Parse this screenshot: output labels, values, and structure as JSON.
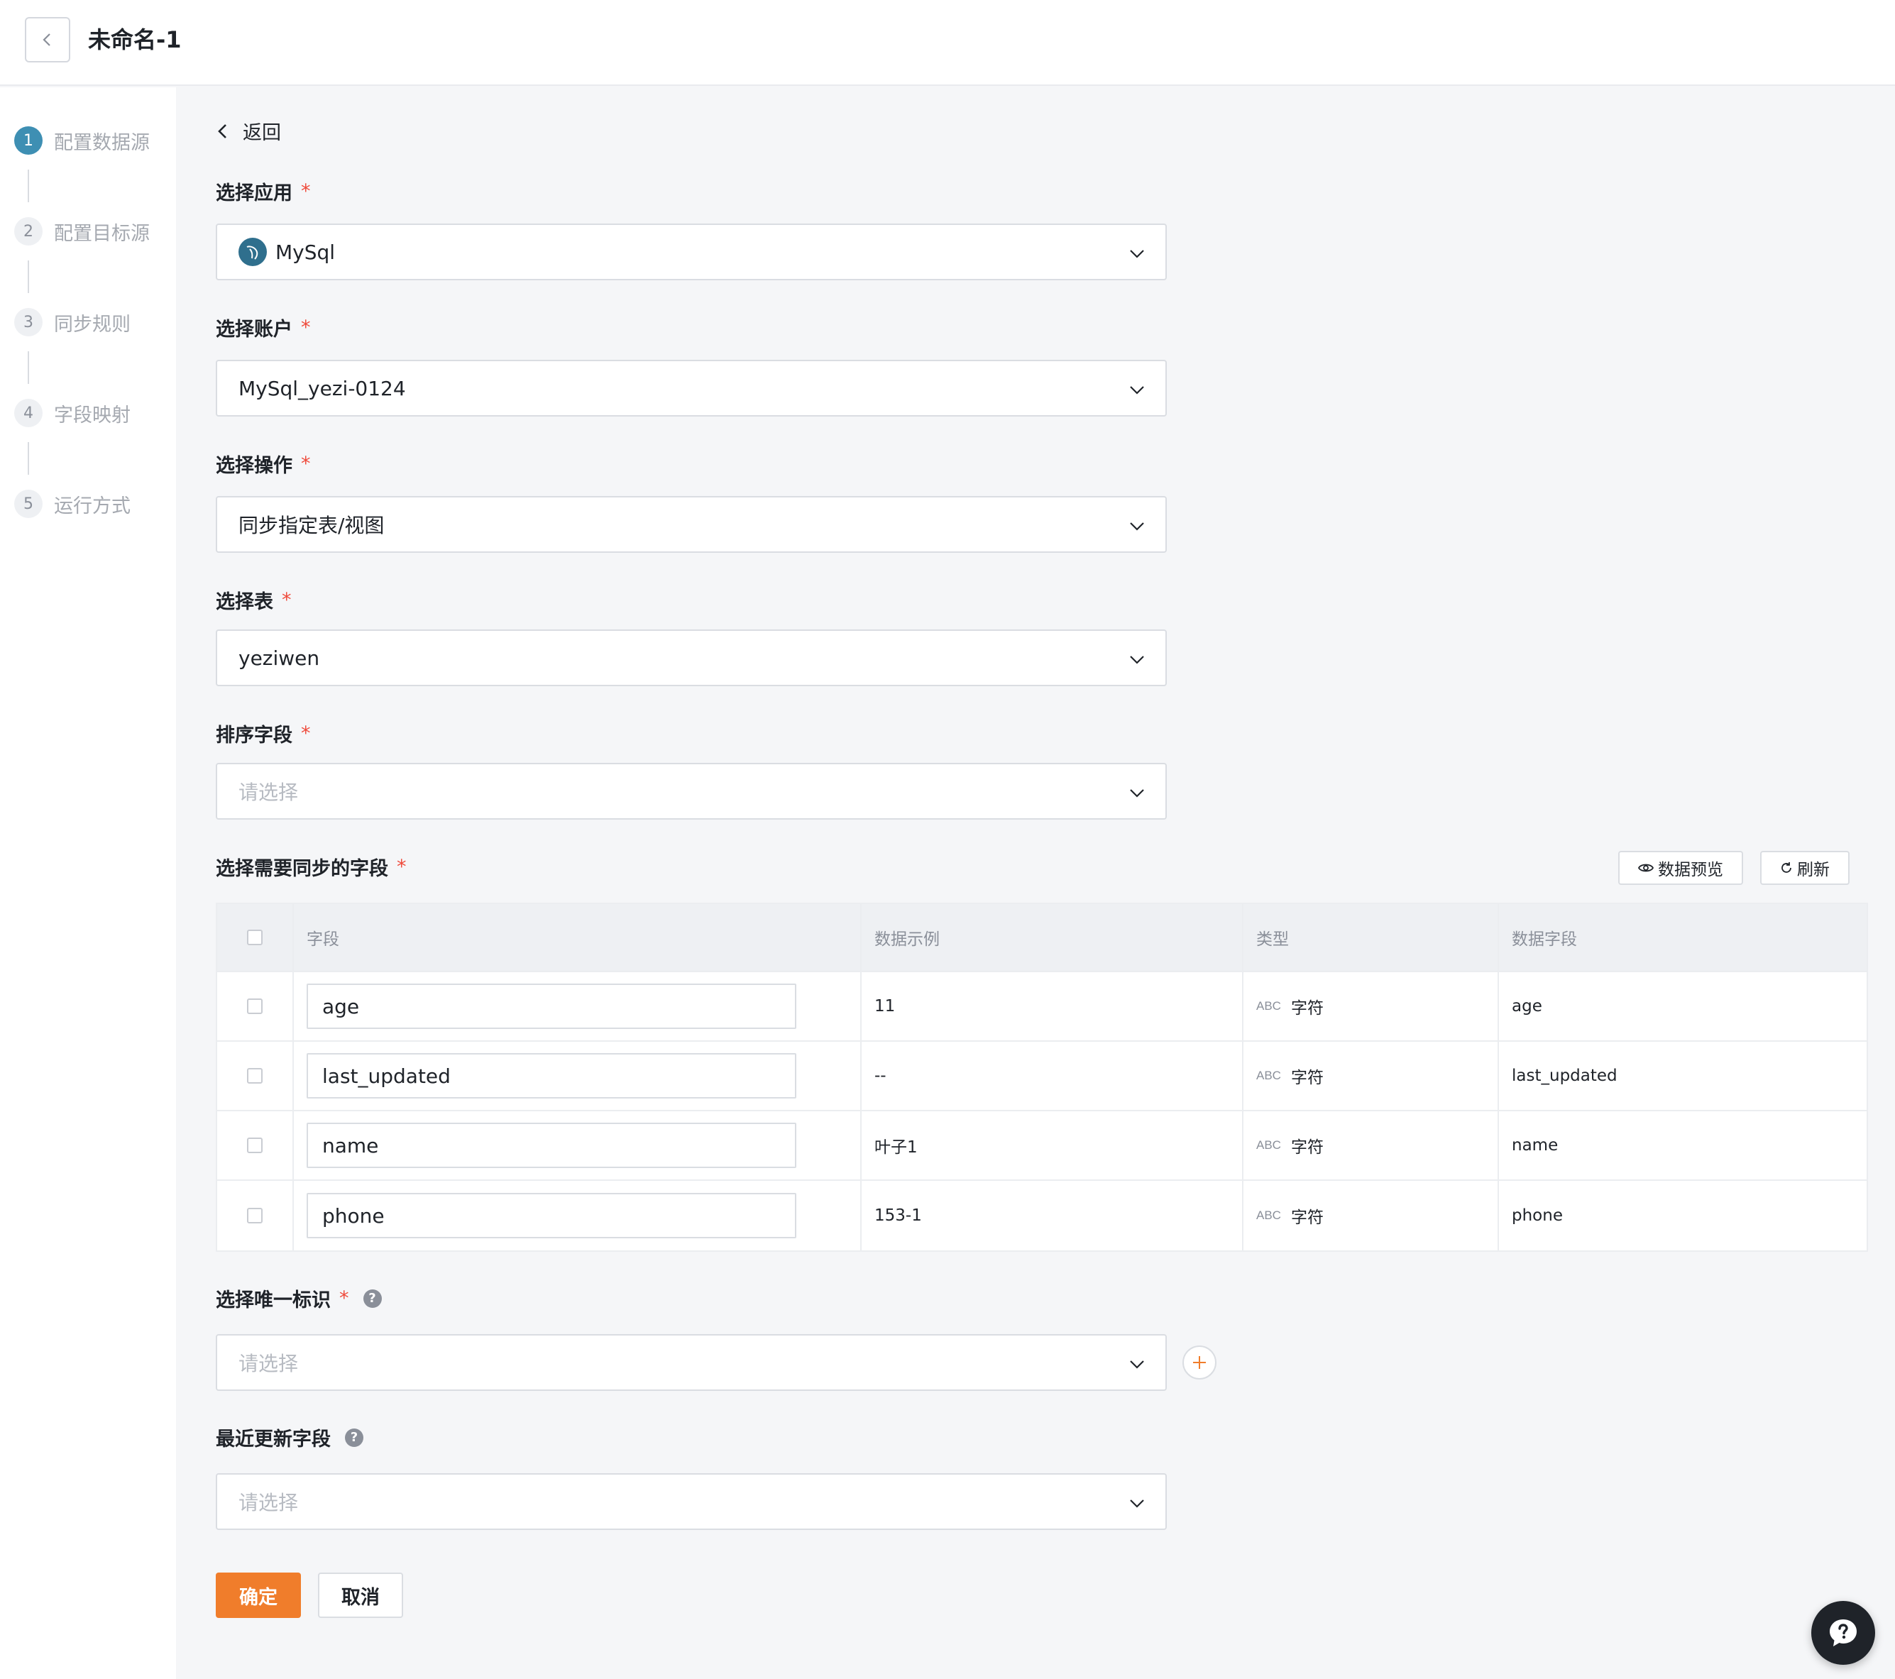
{
  "header": {
    "title": "未命名-1"
  },
  "steps": [
    {
      "num": "1",
      "label": "配置数据源",
      "active": true
    },
    {
      "num": "2",
      "label": "配置目标源",
      "active": false
    },
    {
      "num": "3",
      "label": "同步规则",
      "active": false
    },
    {
      "num": "4",
      "label": "字段映射",
      "active": false
    },
    {
      "num": "5",
      "label": "运行方式",
      "active": false
    }
  ],
  "main": {
    "back_label": "返回",
    "required_mark": "*",
    "app": {
      "label": "选择应用",
      "value": "MySql"
    },
    "account": {
      "label": "选择账户",
      "value": "MySql_yezi-0124"
    },
    "operation": {
      "label": "选择操作",
      "value": "同步指定表/视图"
    },
    "table_select": {
      "label": "选择表",
      "value": "yeziwen"
    },
    "sort_field": {
      "label": "排序字段",
      "placeholder": "请选择"
    },
    "sync_fields": {
      "label": "选择需要同步的字段",
      "preview_label": "数据预览",
      "refresh_label": "刷新",
      "columns": [
        "字段",
        "数据示例",
        "类型",
        "数据字段"
      ],
      "rows": [
        {
          "field": "age",
          "sample": "11",
          "type_icon": "ABC",
          "type": "字符",
          "data_field": "age"
        },
        {
          "field": "last_updated",
          "sample": "--",
          "type_icon": "ABC",
          "type": "字符",
          "data_field": "last_updated"
        },
        {
          "field": "name",
          "sample": "叶子1",
          "type_icon": "ABC",
          "type": "字符",
          "data_field": "name"
        },
        {
          "field": "phone",
          "sample": "153-1",
          "type_icon": "ABC",
          "type": "字符",
          "data_field": "phone"
        }
      ]
    },
    "unique_id": {
      "label": "选择唯一标识",
      "placeholder": "请选择"
    },
    "recent_update": {
      "label": "最近更新字段",
      "placeholder": "请选择"
    },
    "confirm_label": "确定",
    "cancel_label": "取消"
  },
  "colors": {
    "accent": "#f07d2b",
    "step_active": "#3e8fb3",
    "required": "#ef4b3c"
  }
}
